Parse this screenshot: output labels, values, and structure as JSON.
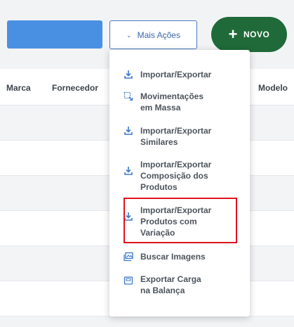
{
  "toolbar": {
    "more_actions_label": "Mais Ações",
    "new_label": "NOVO"
  },
  "table": {
    "headers": {
      "marca": "Marca",
      "fornecedor": "Fornecedor",
      "modelo": "Modelo"
    },
    "row_count": 6
  },
  "menu": {
    "items": [
      {
        "label": "Importar/Exportar",
        "icon": "download-icon"
      },
      {
        "label": "Movimentações\nem Massa",
        "icon": "bulk-move-icon"
      },
      {
        "label": "Importar/Exportar\nSimilares",
        "icon": "download-icon"
      },
      {
        "label": "Importar/Exportar\nComposição dos\nProdutos",
        "icon": "download-icon"
      },
      {
        "label": "Importar/Exportar\nProdutos com\nVariação",
        "icon": "download-icon"
      },
      {
        "label": "Buscar Imagens",
        "icon": "images-icon"
      },
      {
        "label": "Exportar Carga\nna Balança",
        "icon": "scale-icon"
      }
    ]
  },
  "colors": {
    "accent_blue": "#4a90e2",
    "new_button_green": "#1f6a38",
    "highlight_red": "#e0141e",
    "icon_blue": "#3f78c9"
  }
}
